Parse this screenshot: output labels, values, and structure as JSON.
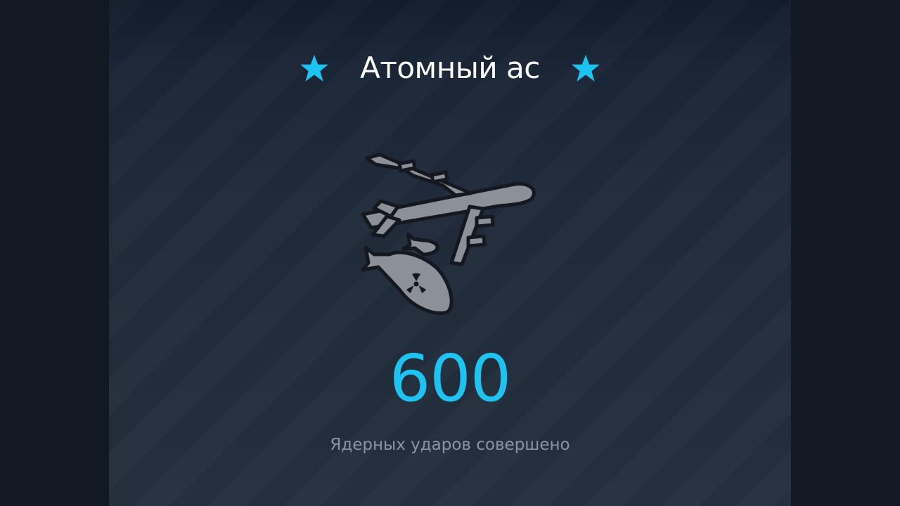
{
  "achievement": {
    "title": "Атомный ас",
    "count": "600",
    "caption": "Ядерных ударов совершено",
    "icon": "bomber-with-nuclear-bombs-icon"
  },
  "colors": {
    "accent": "#1fc3f2",
    "title": "#ffffff",
    "caption": "#8a94a1",
    "icon_fill": "#8c9199",
    "icon_outline": "#15181e"
  }
}
